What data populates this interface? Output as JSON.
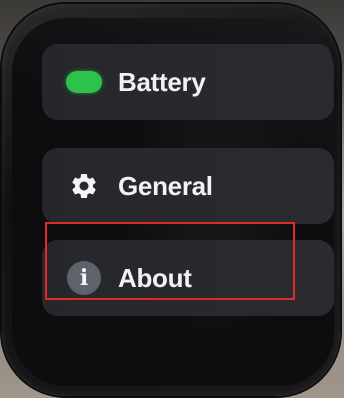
{
  "menu": {
    "items": [
      {
        "label": "Battery",
        "icon": "battery-icon"
      },
      {
        "label": "General",
        "icon": "gear-icon"
      },
      {
        "label": "About",
        "icon": "info-icon",
        "highlighted": true
      }
    ]
  },
  "colors": {
    "battery": "#2ec24a",
    "highlight": "#e02a2a",
    "tile": "#26272b"
  }
}
